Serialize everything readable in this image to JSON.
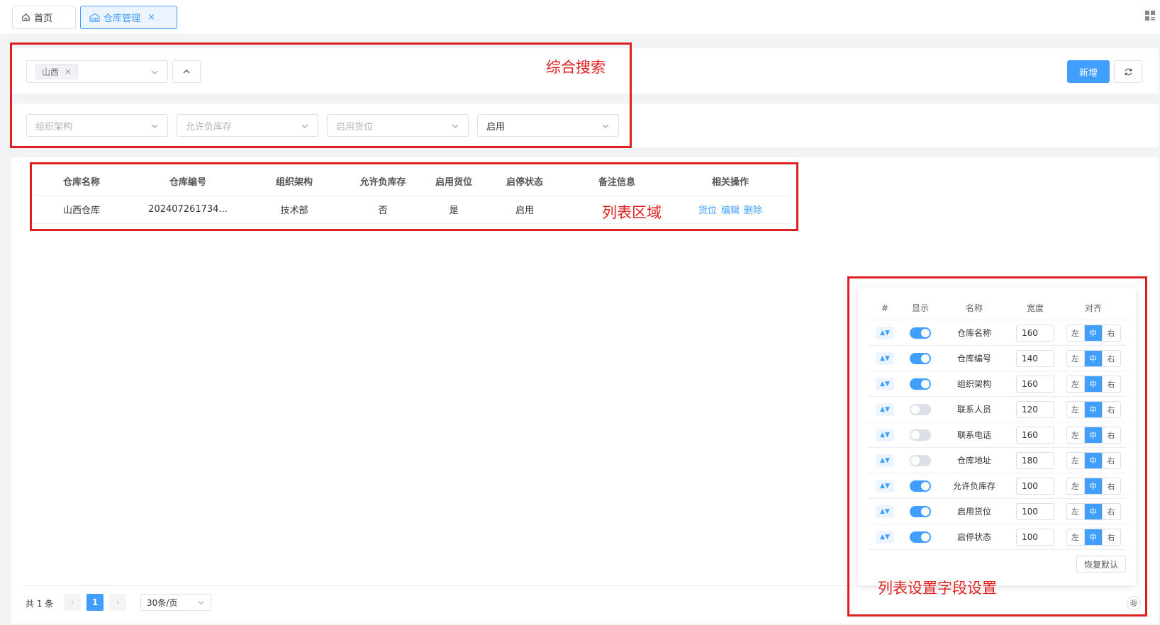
{
  "tabs": [
    {
      "label": "首页",
      "icon": "home-icon"
    },
    {
      "label": "仓库管理",
      "icon": "warehouse-icon",
      "close": "×"
    }
  ],
  "search": {
    "tag_value": "山西",
    "tag_remove": "×",
    "org_placeholder": "组织架构",
    "negative_stock_placeholder": "允许负库存",
    "location_placeholder": "启用货位",
    "status_value": "启用"
  },
  "actions": {
    "add_label": "新增"
  },
  "annotations": {
    "search": "综合搜索",
    "list": "列表区域",
    "settings": "列表设置字段设置"
  },
  "table": {
    "headers": [
      "仓库名称",
      "仓库编号",
      "组织架构",
      "允许负库存",
      "启用货位",
      "启停状态",
      "备注信息",
      "相关操作"
    ],
    "rows": [
      {
        "name": "山西仓库",
        "code": "202407261734...",
        "org": "技术部",
        "negative": "否",
        "location": "是",
        "status": "启用",
        "remark": "",
        "ops": [
          "货位",
          "编辑",
          "删除"
        ]
      }
    ]
  },
  "pagination": {
    "total": "共 1 条",
    "prev": "‹",
    "current": "1",
    "next": "›",
    "page_size": "30条/页"
  },
  "settings": {
    "headers": [
      "#",
      "显示",
      "名称",
      "宽度",
      "对齐"
    ],
    "align_options": [
      "左",
      "中",
      "右"
    ],
    "reset_label": "恢复默认",
    "rows": [
      {
        "name": "仓库名称",
        "width": "160",
        "visible": true
      },
      {
        "name": "仓库编号",
        "width": "140",
        "visible": true
      },
      {
        "name": "组织架构",
        "width": "160",
        "visible": true
      },
      {
        "name": "联系人员",
        "width": "120",
        "visible": false
      },
      {
        "name": "联系电话",
        "width": "160",
        "visible": false
      },
      {
        "name": "仓库地址",
        "width": "180",
        "visible": false
      },
      {
        "name": "允许负库存",
        "width": "100",
        "visible": true
      },
      {
        "name": "启用货位",
        "width": "100",
        "visible": true
      },
      {
        "name": "启停状态",
        "width": "100",
        "visible": true
      }
    ]
  },
  "colors": {
    "primary": "#409eff",
    "annotation": "#e02020"
  }
}
